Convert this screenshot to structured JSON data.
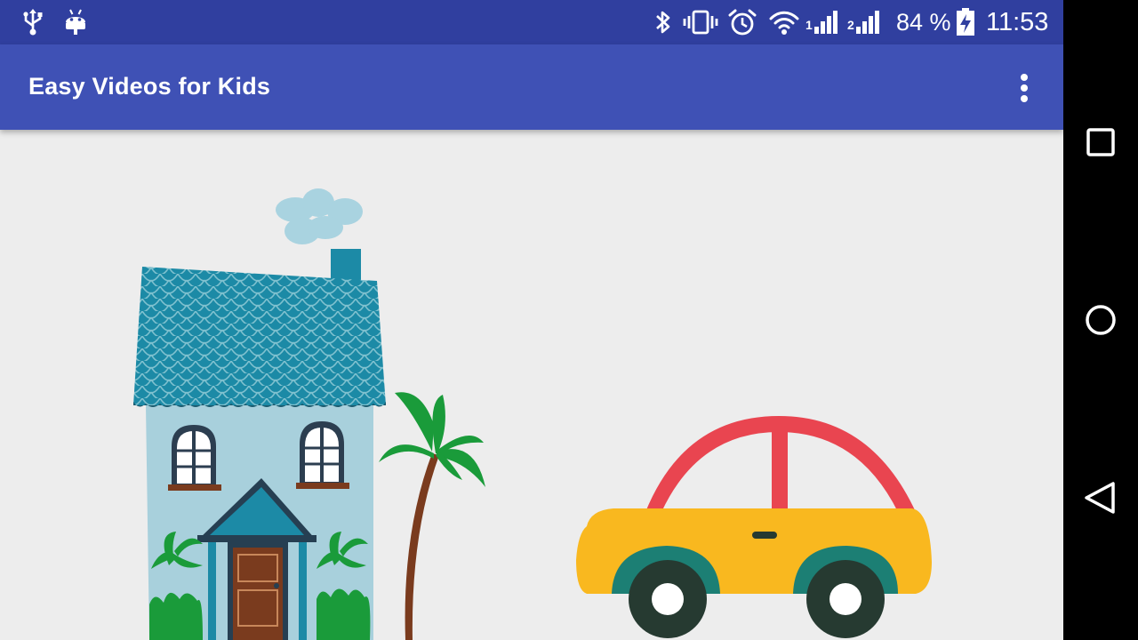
{
  "status_bar": {
    "icons": [
      "usb-icon",
      "android-debug-icon",
      "bluetooth-icon",
      "vibrate-icon",
      "alarm-icon",
      "wifi-icon",
      "signal-sim1-icon",
      "signal-sim2-icon",
      "battery-charging-icon"
    ],
    "sim1_label": "1",
    "sim2_label": "2",
    "battery_text": "84 %",
    "time": "11:53",
    "background_color": "#303f9f"
  },
  "app_bar": {
    "title": "Easy Videos for Kids",
    "menu_icon": "more-vert-icon",
    "background_color": "#3f51b5"
  },
  "content": {
    "background_color": "#ededed",
    "illustrations": [
      "house-illustration",
      "palm-tree-illustration",
      "car-illustration"
    ]
  },
  "nav_bar": {
    "buttons": [
      "recents-button",
      "home-button",
      "back-button"
    ]
  }
}
